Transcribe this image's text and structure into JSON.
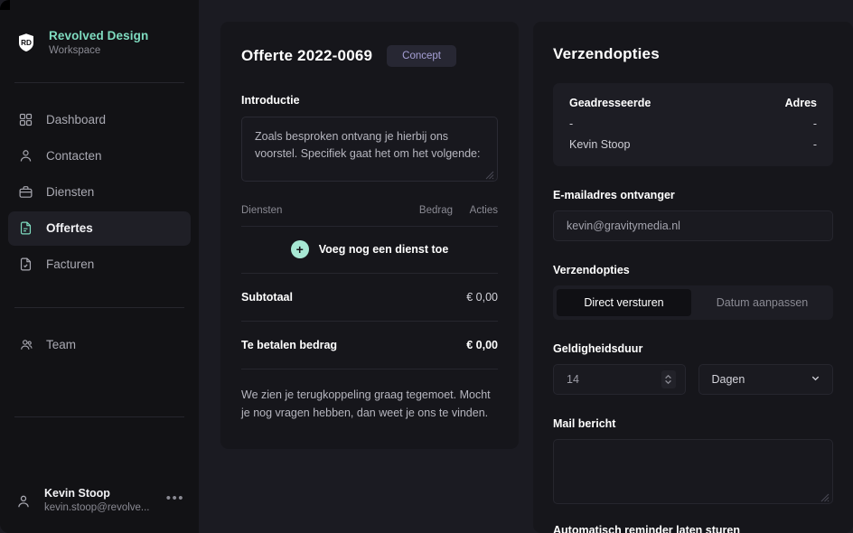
{
  "brand": {
    "logo_icon": "shield-rd-logo-icon",
    "name": "Revolved Design",
    "subtitle": "Workspace",
    "accent": "#7fdcc0"
  },
  "sidebar": {
    "items": [
      {
        "label": "Dashboard",
        "icon": "grid-icon",
        "active": false
      },
      {
        "label": "Contacten",
        "icon": "user-icon",
        "active": false
      },
      {
        "label": "Diensten",
        "icon": "briefcase-icon",
        "active": false
      },
      {
        "label": "Offertes",
        "icon": "document-lines-icon",
        "active": true
      },
      {
        "label": "Facturen",
        "icon": "document-check-icon",
        "active": false
      }
    ],
    "secondary_items": [
      {
        "label": "Team",
        "icon": "team-icon",
        "active": false
      }
    ],
    "user": {
      "avatar_icon": "user-avatar-icon",
      "name": "Kevin Stoop",
      "email": "kevin.stoop@revolve...",
      "menu_icon": "more-dots-icon"
    }
  },
  "quote": {
    "title": "Offerte 2022-0069",
    "status_badge": "Concept",
    "badge_color": "#a6a0d6",
    "intro_label": "Introductie",
    "intro_text": "Zoals besproken ontvang je hierbij ons voorstel. Specifiek gaat het om het volgende:",
    "table": {
      "headers": {
        "services": "Diensten",
        "amount": "Bedrag",
        "actions": "Acties"
      },
      "rows": [],
      "add_row_label": "Voeg nog een dienst toe",
      "add_icon": "plus-circle-icon"
    },
    "subtotal_label": "Subtotaal",
    "subtotal_value": "€ 0,00",
    "total_label": "Te betalen bedrag",
    "total_value": "€ 0,00",
    "outro_text": "We zien je terugkoppeling graag tegemoet. Mocht je nog vragen hebben, dan weet je ons te vinden."
  },
  "send": {
    "title": "Verzendopties",
    "address_card": {
      "col_recipient": "Geadresseerde",
      "col_address": "Adres",
      "rows": [
        {
          "recipient": "-",
          "address": "-"
        },
        {
          "recipient": "Kevin Stoop",
          "address": "-"
        }
      ]
    },
    "email_label": "E-mailadres ontvanger",
    "email_value": "kevin@gravitymedia.nl",
    "options_label": "Verzendopties",
    "options": [
      {
        "label": "Direct versturen",
        "active": true
      },
      {
        "label": "Datum aanpassen",
        "active": false
      }
    ],
    "validity_label": "Geldigheidsduur",
    "validity_value": "14",
    "validity_unit": "Dagen",
    "unit_chevron_icon": "chevron-down-icon",
    "stepper_icon": "stepper-arrows-icon",
    "mail_label": "Mail bericht",
    "mail_value": "",
    "reminder_label": "Automatisch reminder laten sturen"
  }
}
